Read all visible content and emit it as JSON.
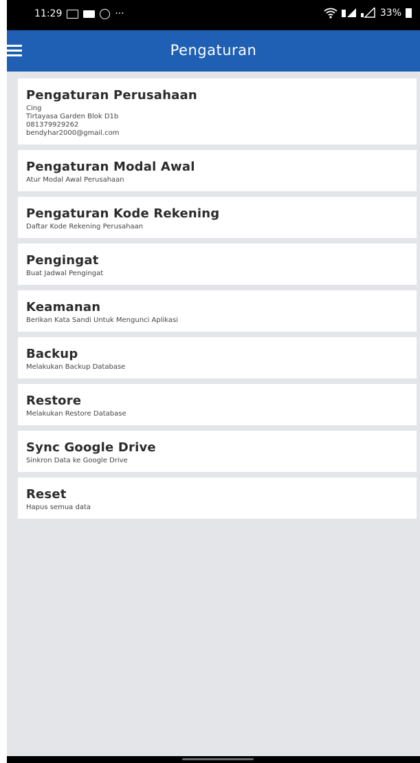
{
  "status_bar": {
    "time": "11:29",
    "more": "···",
    "battery_text": "33%"
  },
  "app_bar": {
    "title": "Pengaturan"
  },
  "settings": [
    {
      "title": "Pengaturan Perusahaan",
      "lines": [
        "Cing",
        "Tirtayasa Garden Blok D1b",
        "081379929262",
        "bendyhar2000@gmail.com"
      ]
    },
    {
      "title": "Pengaturan Modal Awal",
      "lines": [
        "Atur Modal Awal Perusahaan"
      ]
    },
    {
      "title": "Pengaturan Kode Rekening",
      "lines": [
        "Daftar Kode Rekening Perusahaan"
      ]
    },
    {
      "title": "Pengingat",
      "lines": [
        "Buat Jadwal Pengingat"
      ]
    },
    {
      "title": "Keamanan",
      "lines": [
        "Berikan Kata Sandi Untuk Mengunci Aplikasi"
      ]
    },
    {
      "title": "Backup",
      "lines": [
        "Melakukan Backup Database"
      ]
    },
    {
      "title": "Restore",
      "lines": [
        "Melakukan Restore Database"
      ]
    },
    {
      "title": "Sync Google Drive",
      "lines": [
        "Sinkron Data ke Google Drive"
      ]
    },
    {
      "title": "Reset",
      "lines": [
        "Hapus semua data"
      ]
    }
  ],
  "icons": {
    "menu": "hamburger-menu-icon",
    "wifi": "wifi-icon",
    "battery": "battery-icon"
  },
  "colors": {
    "app_bar": "#1f5fb4",
    "background": "#e4e5e9",
    "status_bar": "#000000"
  }
}
